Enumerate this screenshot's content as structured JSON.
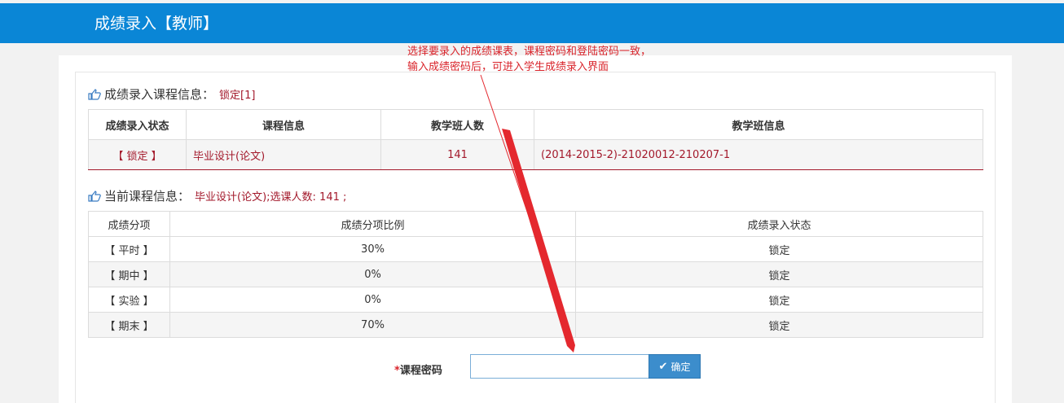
{
  "header": {
    "title": "成绩录入【教师】"
  },
  "annotation": {
    "line1": "选择要录入的成绩课表，课程密码和登陆密码一致，",
    "line2": "输入成绩密码后，可进入学生成绩录入界面",
    "color": "#d9242b"
  },
  "course_section": {
    "title": "成绩录入课程信息：",
    "status_value": "锁定[1]",
    "columns": [
      "成绩录入状态",
      "课程信息",
      "教学班人数",
      "教学班信息"
    ],
    "row": {
      "status": "【 锁定 】",
      "course": "毕业设计(论文)",
      "count": "141",
      "class_info": "(2014-2015-2)-21020012-210207-1"
    }
  },
  "current_section": {
    "title": "当前课程信息：",
    "value": "毕业设计(论文);选课人数: 141 ;",
    "columns": [
      "成绩分项",
      "成绩分项比例",
      "成绩录入状态"
    ],
    "rows": [
      {
        "item": "【 平时 】",
        "ratio": "30%",
        "status": "锁定"
      },
      {
        "item": "【 期中 】",
        "ratio": "0%",
        "status": "锁定"
      },
      {
        "item": "【 实验 】",
        "ratio": "0%",
        "status": "锁定"
      },
      {
        "item": "【 期末 】",
        "ratio": "70%",
        "status": "锁定"
      }
    ]
  },
  "password": {
    "required_mark": "*",
    "label": "课程密码",
    "value": "",
    "placeholder": "",
    "confirm_label": "确定"
  },
  "icons": {
    "section": "pointing-hand-icon",
    "confirm": "check-icon"
  },
  "colors": {
    "brand": "#0a86d6",
    "accent": "#a3192b",
    "button": "#3c8dcc"
  }
}
